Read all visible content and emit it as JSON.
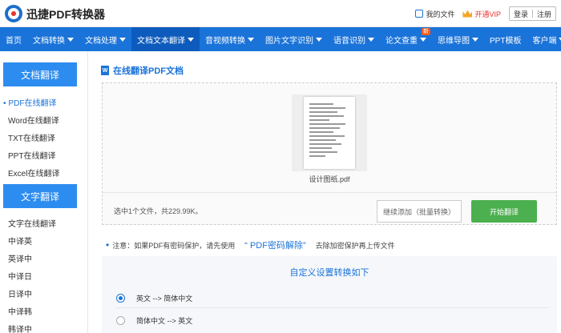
{
  "header": {
    "brand": "迅捷PDF转换器",
    "my_files": "我的文件",
    "vip": "开通VIP",
    "login": "登录",
    "register": "注册"
  },
  "nav": [
    {
      "label": "首页",
      "caret": false
    },
    {
      "label": "文档转换",
      "caret": true
    },
    {
      "label": "文档处理",
      "caret": true
    },
    {
      "label": "文档文本翻译",
      "caret": true,
      "active": true
    },
    {
      "label": "音视频转换",
      "caret": true
    },
    {
      "label": "图片文字识别",
      "caret": true
    },
    {
      "label": "语音识别",
      "caret": true
    },
    {
      "label": "论文查重",
      "caret": true,
      "badge": "新"
    },
    {
      "label": "思维导图",
      "caret": true
    },
    {
      "label": "PPT模板",
      "caret": false
    },
    {
      "label": "客户端",
      "caret": true
    }
  ],
  "sidebar": {
    "section1": "文档翻译",
    "items1": [
      "PDF在线翻译",
      "Word在线翻译",
      "TXT在线翻译",
      "PPT在线翻译",
      "Excel在线翻译"
    ],
    "section2": "文字翻译",
    "items2": [
      "文字在线翻译",
      "中译英",
      "英译中",
      "中译日",
      "日译中",
      "中译韩",
      "韩译中"
    ]
  },
  "main": {
    "title": "在线翻译PDF文档",
    "file_name": "设计图纸.pdf",
    "file_info": "选中1个文件，共229.99K。",
    "add_button": "继续添加（批量转换）",
    "start_button": "开始翻译",
    "notice_prefix": "注意：如果PDF有密码保护，请先使用",
    "notice_link": "“ PDF密码解除”",
    "notice_suffix": "去除加密保护再上传文件",
    "settings_title": "自定义设置转换如下",
    "options": [
      "英文 --> 简体中文",
      "简体中文 --> 英文"
    ]
  }
}
